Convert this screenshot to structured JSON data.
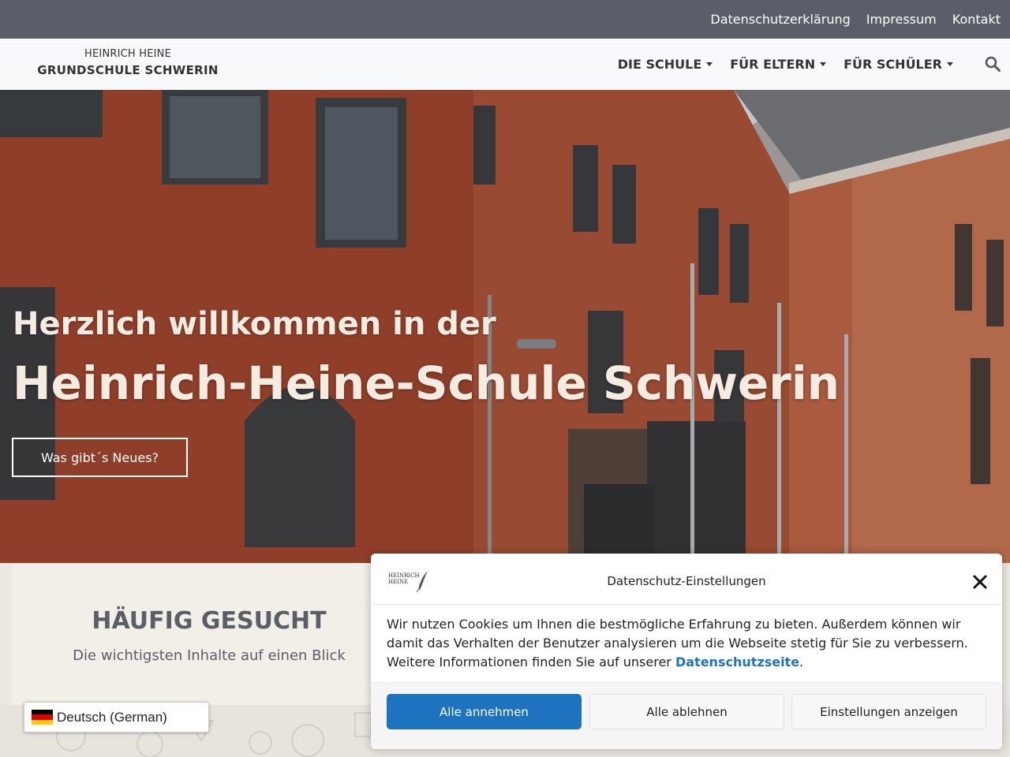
{
  "topbar": {
    "links": [
      "Datenschutzerklärung",
      "Impressum",
      "Kontakt"
    ]
  },
  "header": {
    "logo_line1": "HEINRICH HEINE",
    "logo_line2": "GRUNDSCHULE SCHWERIN",
    "nav": [
      "DIE SCHULE",
      "FÜR ELTERN",
      "FÜR SCHÜLER"
    ],
    "search_icon": "search-icon"
  },
  "hero": {
    "subtitle": "Herzlich willkommen in der",
    "title": "Heinrich-Heine-Schule Schwerin",
    "button_label": "Was gibt´s Neues?"
  },
  "section": {
    "title": "HÄUFIG GESUCHT",
    "subtitle": "Die wichtigsten Inhalte auf einen Blick"
  },
  "language": {
    "label": "Deutsch (German)",
    "flag_colors": [
      "#000000",
      "#dd0000",
      "#ffce00"
    ]
  },
  "cookie": {
    "logo_text_1": "HEINRICH",
    "logo_text_2": "HEINE",
    "title": "Datenschutz-Einstellungen",
    "body_text": "Wir nutzen Cookies um Ihnen die bestmögliche Erfahrung zu bieten. Außerdem können wir damit das Verhalten der Benutzer analysieren um die Webseite stetig für Sie zu verbessern. Weitere Informationen finden Sie auf unserer ",
    "link_text": "Datenschutzseite",
    "body_end": ".",
    "btn_accept": "Alle annehmen",
    "btn_reject": "Alle ablehnen",
    "btn_settings": "Einstellungen anzeigen",
    "accent_color": "#1e73be"
  }
}
